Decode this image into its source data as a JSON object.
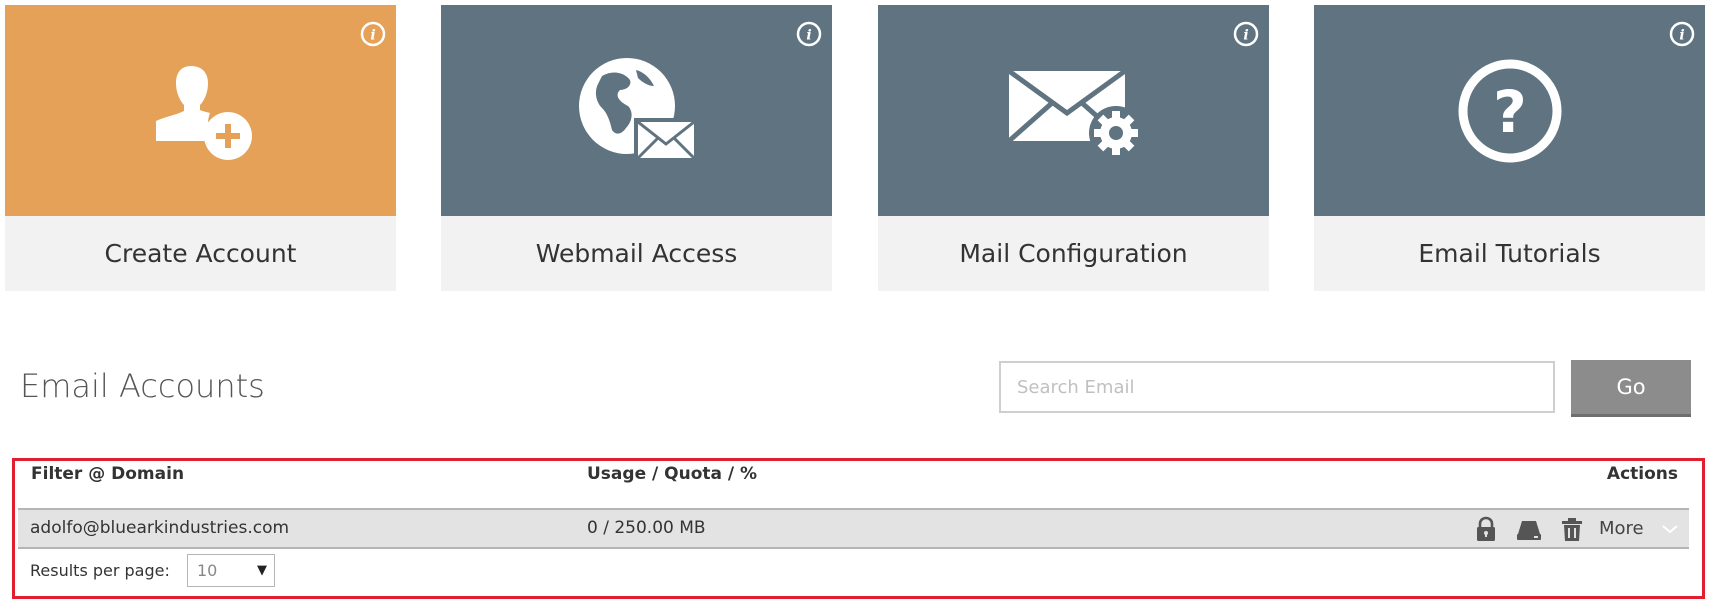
{
  "tiles": [
    {
      "label": "Create Account",
      "icon": "add-user-icon",
      "color": "#e5a157"
    },
    {
      "label": "Webmail Access",
      "icon": "globe-mail-icon",
      "color": "#5f7480"
    },
    {
      "label": "Mail Configuration",
      "icon": "mail-gear-icon",
      "color": "#5f7480"
    },
    {
      "label": "Email Tutorials",
      "icon": "question-icon",
      "color": "#5f7480"
    }
  ],
  "section_title": "Email Accounts",
  "search": {
    "placeholder": "Search Email",
    "button_label": "Go"
  },
  "table": {
    "columns": [
      "Filter @ Domain",
      "Usage / Quota / %",
      "Actions"
    ],
    "rows": [
      {
        "email": "adolfo@bluearkindustries.com",
        "usage": "0 / 250.00 MB",
        "actions": [
          "lock-icon",
          "drive-icon",
          "trash-icon"
        ],
        "more_label": "More"
      }
    ]
  },
  "pagination": {
    "results_label": "Results per page:",
    "per_page_value": "10"
  },
  "colors": {
    "orange_tile": "#e5a157",
    "slate_tile": "#5f7480",
    "highlight_border": "#e0202e",
    "go_button": "#8c8c8c"
  }
}
